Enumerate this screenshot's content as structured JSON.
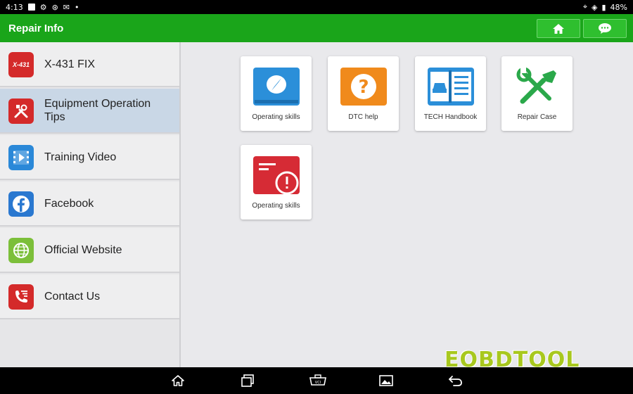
{
  "status_bar": {
    "time": "4:13",
    "battery": "48%"
  },
  "header": {
    "title": "Repair Info"
  },
  "sidebar": {
    "items": [
      {
        "label": "X-431 FIX",
        "icon": "x431-fix-icon",
        "badge": "X-431",
        "color": "#d42a2a"
      },
      {
        "label": "Equipment Operation Tips",
        "icon": "tools-icon",
        "color": "#d42a2a"
      },
      {
        "label": "Training Video",
        "icon": "video-icon",
        "color": "#2a88d8"
      },
      {
        "label": "Facebook",
        "icon": "facebook-icon",
        "color": "#2a78d0"
      },
      {
        "label": "Official Website",
        "icon": "globe-icon",
        "color": "#7cbf3a"
      },
      {
        "label": "Contact Us",
        "icon": "contact-icon",
        "color": "#d42a2a"
      }
    ]
  },
  "tiles": [
    {
      "label": "Operating skills",
      "icon": "compass-book-icon",
      "color": "#2b8fd9"
    },
    {
      "label": "DTC help",
      "icon": "question-icon",
      "color": "#f08a1c"
    },
    {
      "label": "TECH Handbook",
      "icon": "car-handbook-icon",
      "color": "#2b8fd9"
    },
    {
      "label": "Repair Case",
      "icon": "wrench-screwdriver-icon",
      "color": "#2aa84a"
    },
    {
      "label": "Operating skills",
      "icon": "warning-card-icon",
      "color": "#d62b35"
    }
  ],
  "watermark": "EOBDTOOL"
}
